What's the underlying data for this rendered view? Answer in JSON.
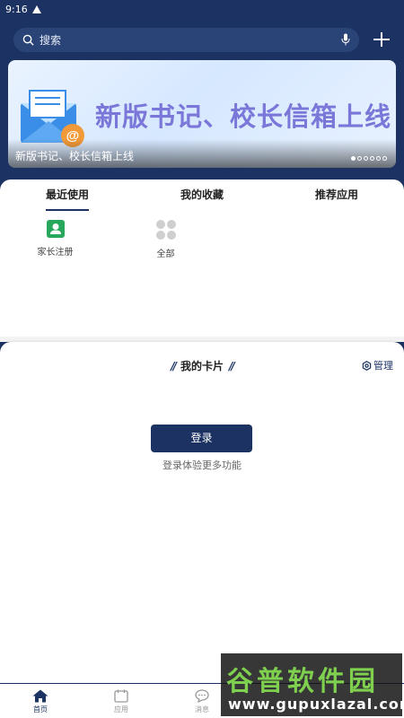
{
  "status": {
    "time": "9:16"
  },
  "search": {
    "placeholder": "搜索"
  },
  "banner": {
    "headline": "新版书记、校长信箱上线",
    "caption": "新版书记、校长信箱上线",
    "dot_count": 6,
    "active_dot": 0
  },
  "tabs": [
    {
      "label": "最近使用",
      "active": true
    },
    {
      "label": "我的收藏",
      "active": false
    },
    {
      "label": "推荐应用",
      "active": false
    }
  ],
  "apps": [
    {
      "label": "家长注册",
      "icon": "user-card-icon"
    },
    {
      "label": "全部",
      "icon": "grid-icon"
    }
  ],
  "card": {
    "title": "我的卡片",
    "manage_label": "管理",
    "login_label": "登录",
    "login_tip": "登录体验更多功能"
  },
  "nav": [
    {
      "label": "首页",
      "icon": "home-icon",
      "active": true
    },
    {
      "label": "应用",
      "icon": "calendar-icon",
      "active": false
    },
    {
      "label": "消息",
      "icon": "chat-icon",
      "active": false
    }
  ],
  "watermark": {
    "line1": "谷普软件园",
    "line2": "www.gupuxlazal.com"
  },
  "colors": {
    "primary": "#1b3263",
    "banner_text": "#7a77d8",
    "watermark_green": "#7ed04e"
  }
}
